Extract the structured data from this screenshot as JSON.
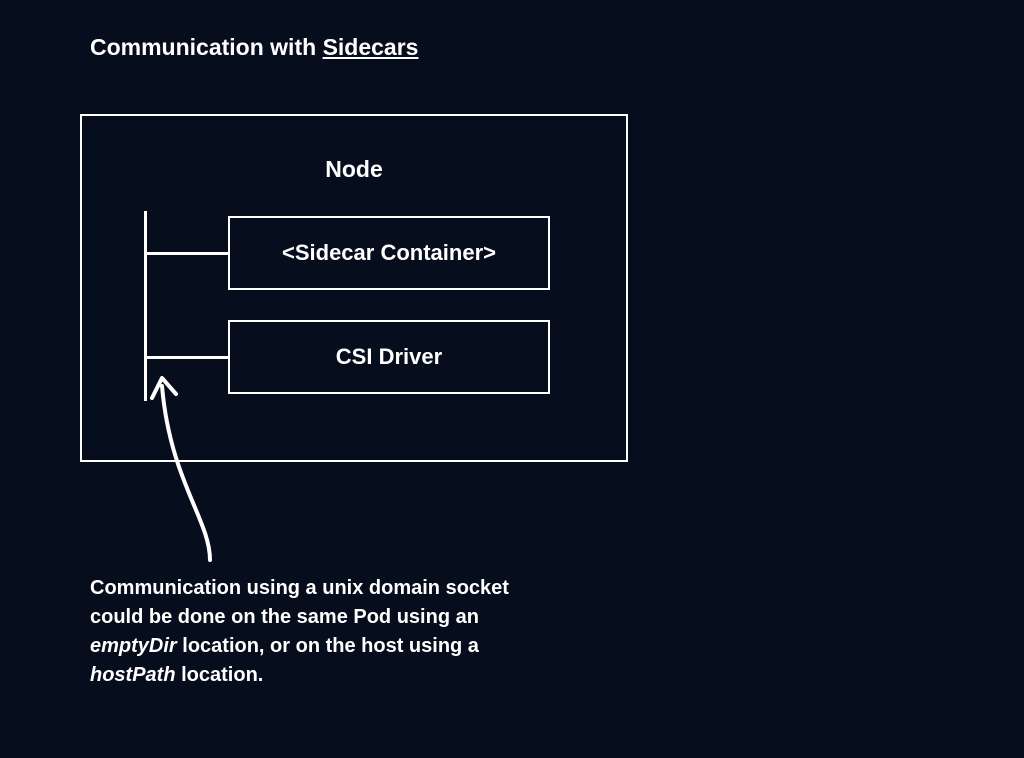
{
  "title": {
    "prefix": "Communication with ",
    "underlined": "Sidecars"
  },
  "diagram": {
    "node_label": "Node",
    "sidecar_label": "<Sidecar Container>",
    "csi_label": "CSI Driver"
  },
  "caption": {
    "part1": "Communication using a unix domain socket could be done on the same Pod using an ",
    "italic1": "emptyDir",
    "part2": " location, or on the host using a ",
    "italic2": "hostPath",
    "part3": " location."
  }
}
